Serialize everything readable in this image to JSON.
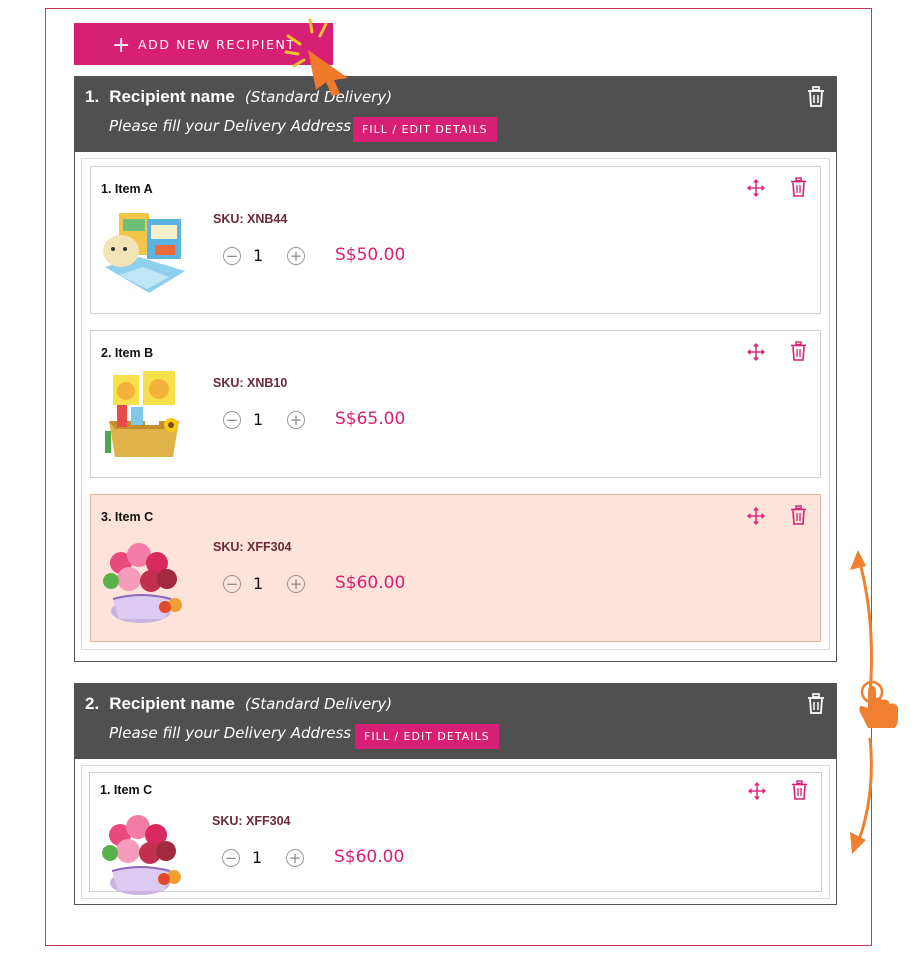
{
  "add_button": {
    "icon": "plus-icon",
    "label": "ADD NEW RECIPIENT"
  },
  "recipients": [
    {
      "number": "1.",
      "name": "Recipient name",
      "delivery": "(Standard Delivery)",
      "address_prompt": "Please fill your Delivery Address",
      "fill_button": "FILL / EDIT DETAILS",
      "items": [
        {
          "name": "1. Item A",
          "sku": "SKU: XNB44",
          "qty": "1",
          "price": "S$50.00"
        },
        {
          "name": "2. Item B",
          "sku": "SKU: XNB10",
          "qty": "1",
          "price": "S$65.00"
        },
        {
          "name": "3. Item C",
          "sku": "SKU: XFF304",
          "qty": "1",
          "price": "S$60.00"
        }
      ]
    },
    {
      "number": "2.",
      "name": "Recipient name",
      "delivery": "(Standard Delivery)",
      "address_prompt": "Please fill your Delivery Address",
      "fill_button": "FILL / EDIT DETAILS",
      "items": [
        {
          "name": "1. Item C",
          "sku": "SKU: XFF304",
          "qty": "1",
          "price": "S$60.00"
        }
      ]
    }
  ],
  "colors": {
    "accent": "#d81f76",
    "header": "#505050",
    "highlight": "#fde3d9",
    "annotation": "#f08030"
  }
}
